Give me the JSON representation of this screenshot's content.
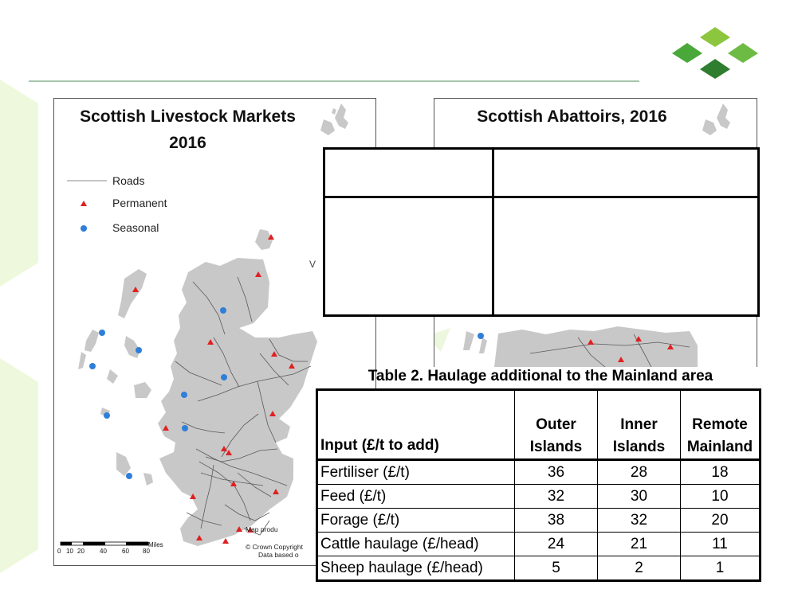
{
  "theme": {
    "accent_green": "#4aa83a",
    "dark_green": "#2f7d2e",
    "light_green": "#eef8dc",
    "permanent_marker": "#e02020",
    "seasonal_marker": "#2f7fd8",
    "land": "#c8c8c8"
  },
  "map_left": {
    "title_line1": "Scottish Livestock Markets",
    "title_line2": "2016",
    "legend": [
      {
        "label": "Roads",
        "symbol": "road-line"
      },
      {
        "label": "Permanent",
        "symbol": "red-triangle"
      },
      {
        "label": "Seasonal",
        "symbol": "blue-circle"
      }
    ],
    "scale": {
      "ticks": [
        "0",
        "10",
        "20",
        "40",
        "60",
        "80"
      ],
      "unit": "Miles"
    },
    "credits": [
      "Map produ",
      "© Crown Copyright",
      "Data based o"
    ]
  },
  "map_right": {
    "title": "Scottish Abattoirs, 2016"
  },
  "stray_text": "V",
  "table": {
    "caption": "Table 2. Haulage additional to the Mainland area",
    "headers": [
      {
        "line1": "",
        "line2": "Input (£/t to add)"
      },
      {
        "line1": "Outer",
        "line2": "Islands"
      },
      {
        "line1": "Inner",
        "line2": "Islands"
      },
      {
        "line1": "Remote",
        "line2": "Mainland"
      }
    ],
    "rows": [
      {
        "input": "Fertiliser (£/t)",
        "outer": "36",
        "inner": "28",
        "remote": "18"
      },
      {
        "input": "Feed (£/t)",
        "outer": "32",
        "inner": "30",
        "remote": "10"
      },
      {
        "input": "Forage (£/t)",
        "outer": "38",
        "inner": "32",
        "remote": "20"
      },
      {
        "input": "Cattle haulage (£/head)",
        "outer": "24",
        "inner": "21",
        "remote": "11"
      },
      {
        "input": "Sheep haulage (£/head)",
        "outer": "5",
        "inner": "2",
        "remote": "1"
      }
    ]
  }
}
